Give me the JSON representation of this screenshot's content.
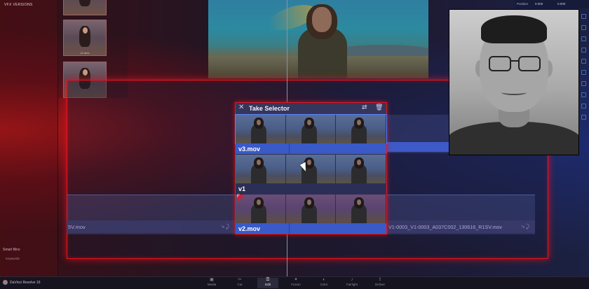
{
  "browser": {
    "header": "VFX VERSIONS",
    "thumb_labels": [
      "",
      "v1.mov",
      ""
    ],
    "smart_bins": "Smart Bins",
    "keywords": "Keywords"
  },
  "inspector": {
    "label": "Position",
    "x": "0.000",
    "y": "0.000"
  },
  "take_selector": {
    "title": "Take Selector",
    "close_icon": "✕",
    "swap_icon": "⇄",
    "trash_icon": "🗑",
    "takes": [
      {
        "name": "v3.mov",
        "selected": true
      },
      {
        "name": "v1",
        "selected": false
      },
      {
        "name": "v2.mov",
        "selected": false,
        "flag": "F"
      }
    ]
  },
  "timeline": {
    "lower_left_clip": "5V.mov",
    "lower_right_clip": "V1-0003_V1-0003_A037C002_130616_R1SV.mov",
    "clip_icons": "⤷ ⤸"
  },
  "bottom": {
    "app_name": "DaVinci Resolve 16",
    "tabs": [
      {
        "icon": "▣",
        "label": "Media"
      },
      {
        "icon": "✂",
        "label": "Cut"
      },
      {
        "icon": "☰",
        "label": "Edit",
        "active": true
      },
      {
        "icon": "✦",
        "label": "Fusion"
      },
      {
        "icon": "◐",
        "label": "Color"
      },
      {
        "icon": "♪",
        "label": "Fairlight"
      },
      {
        "icon": "⇪",
        "label": "Deliver"
      }
    ]
  },
  "colors": {
    "accent_red": "#e5141c",
    "clip_blue": "#3a5ac8"
  }
}
